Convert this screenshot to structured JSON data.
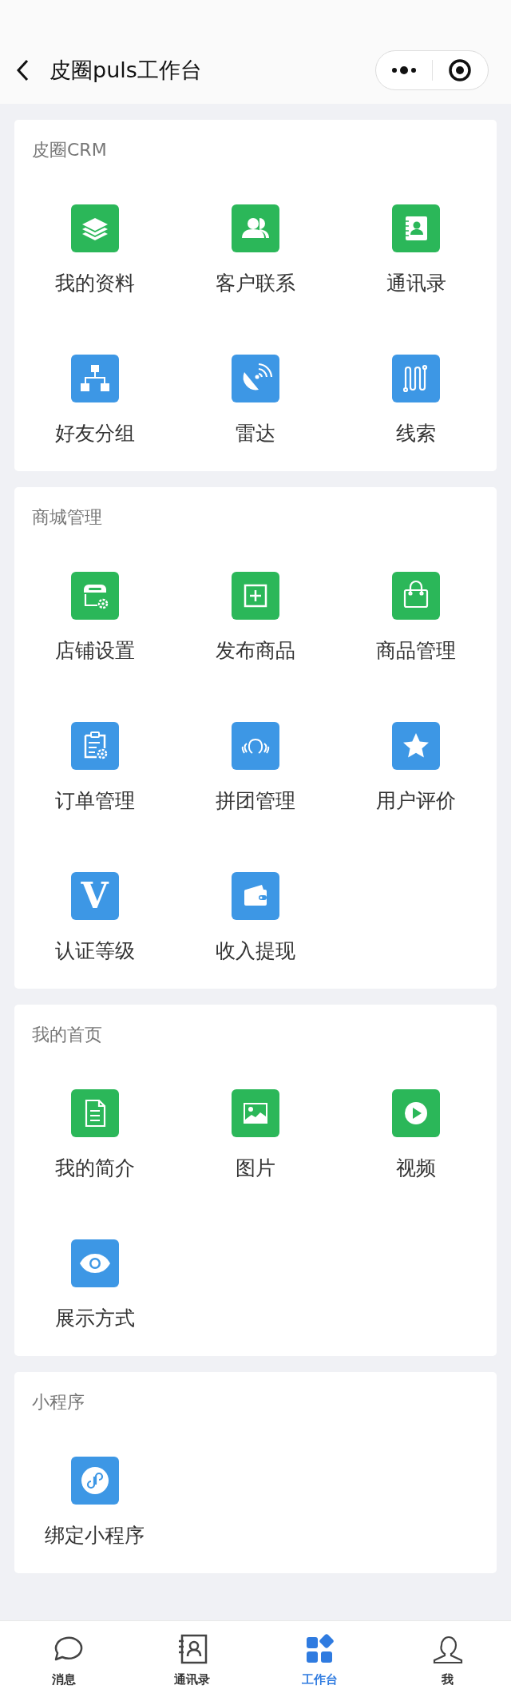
{
  "header": {
    "title": "皮圈puls工作台"
  },
  "sections": [
    {
      "title": "皮圈CRM",
      "items": [
        {
          "label": "我的资料",
          "color": "#2bb759"
        },
        {
          "label": "客户联系",
          "color": "#2bb759"
        },
        {
          "label": "通讯录",
          "color": "#2bb759"
        },
        {
          "label": "好友分组",
          "color": "#3d97e5"
        },
        {
          "label": "雷达",
          "color": "#3d97e5"
        },
        {
          "label": "线索",
          "color": "#3d97e5"
        }
      ]
    },
    {
      "title": "商城管理",
      "items": [
        {
          "label": "店铺设置",
          "color": "#2bb759"
        },
        {
          "label": "发布商品",
          "color": "#2bb759"
        },
        {
          "label": "商品管理",
          "color": "#2bb759"
        },
        {
          "label": "订单管理",
          "color": "#3d97e5"
        },
        {
          "label": "拼团管理",
          "color": "#3d97e5"
        },
        {
          "label": "用户评价",
          "color": "#3d97e5"
        },
        {
          "label": "认证等级",
          "color": "#3d97e5",
          "glyph": "V"
        },
        {
          "label": "收入提现",
          "color": "#3d97e5"
        }
      ]
    },
    {
      "title": "我的首页",
      "items": [
        {
          "label": "我的简介",
          "color": "#2bb759"
        },
        {
          "label": "图片",
          "color": "#2bb759"
        },
        {
          "label": "视频",
          "color": "#2bb759"
        },
        {
          "label": "展示方式",
          "color": "#3d97e5"
        }
      ]
    },
    {
      "title": "小程序",
      "items": [
        {
          "label": "绑定小程序",
          "color": "#3d97e5"
        }
      ]
    }
  ],
  "tabs": [
    {
      "label": "消息",
      "selected": false
    },
    {
      "label": "通讯录",
      "selected": false
    },
    {
      "label": "工作台",
      "selected": true
    },
    {
      "label": "我",
      "selected": false
    }
  ]
}
